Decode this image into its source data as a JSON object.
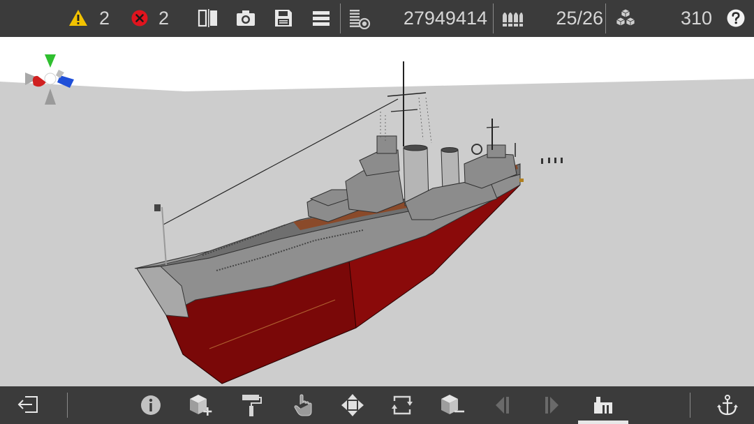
{
  "status": {
    "warnings_count": "2",
    "errors_count": "2",
    "mass_value": "27949414",
    "ammo_value": "25/26",
    "parts_value": "310"
  },
  "colors": {
    "bar_bg": "#3b3b3b",
    "warning": "#f2c200",
    "error": "#e0141e",
    "hull_red": "#8a0a0a",
    "hull_gray": "#8f8f8f",
    "gizmo_y": "#2fbf2f",
    "gizmo_x": "#d02020",
    "gizmo_z": "#1f4fd8"
  },
  "icons": {
    "top": [
      "warning-icon",
      "error-icon",
      "mirror-icon",
      "camera-icon",
      "save-icon",
      "menu-icon",
      "mass-icon",
      "ammo-icon",
      "parts-icon",
      "help-icon"
    ],
    "bottom": [
      "exit-icon",
      "info-icon",
      "add-block-icon",
      "paint-roller-icon",
      "hand-pointer-icon",
      "move-icon",
      "rotate-icon",
      "remove-block-icon",
      "previous-icon",
      "next-icon",
      "build-mode-icon",
      "anchor-icon"
    ]
  },
  "bottom_toolbar": {
    "active_tool": "build-mode"
  }
}
